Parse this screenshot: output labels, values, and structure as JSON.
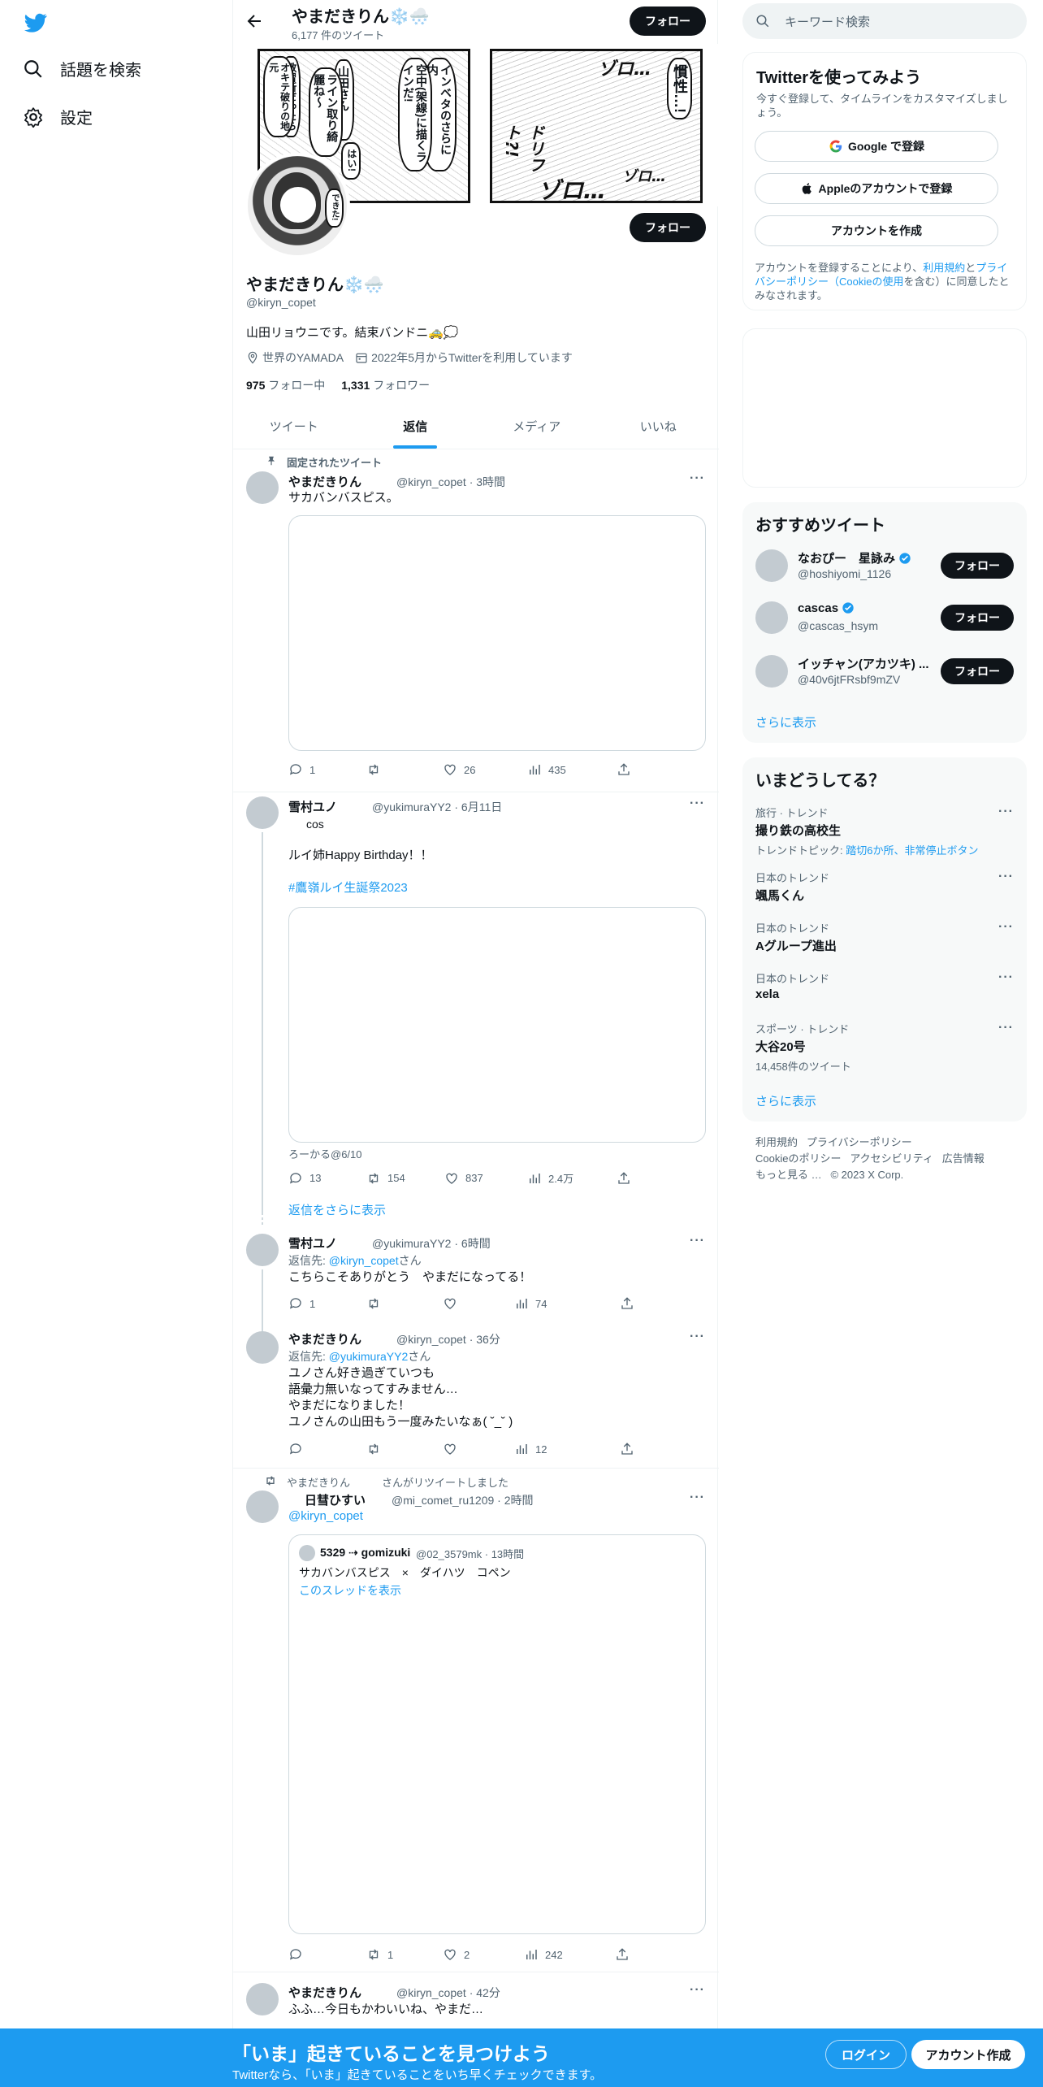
{
  "nav": {
    "explore_label": "話題を検索",
    "settings_label": "設定"
  },
  "header": {
    "name": "やまだきりん❄️🌨️",
    "tweet_count": "6,177 件のツイート",
    "follow_label": "フォロー"
  },
  "banner": {
    "manga_left_bubbles": [
      "インベタのさらに内",
      "空中(架線)に描くラインだ!",
      "山田さん…",
      "ライン取り綺麗ね〜",
      "はい!",
      "教習所だったら",
      "オキテ破りの地元",
      "できた!"
    ],
    "manga_right_text": [
      "慣性…!",
      "ドリフト?!",
      "ゾロ…",
      "ゾロ…",
      "ゾロ…"
    ]
  },
  "profile": {
    "follow_label": "フォロー",
    "name": "やまだきりん❄️🌨️",
    "handle": "@kiryn_copet",
    "bio": "山田リョウニです。結束バンドニ🚕💭",
    "location": "世界のYAMADA",
    "joined": "2022年5月からTwitterを利用しています",
    "following_count": "975",
    "following_label": "フォロー中",
    "followers_count": "1,331",
    "followers_label": "フォロワー"
  },
  "tabs": [
    {
      "label": "ツイート"
    },
    {
      "label": "返信"
    },
    {
      "label": "メディア"
    },
    {
      "label": "いいね"
    }
  ],
  "tweets": [
    {
      "pinned_label": "固定されたツイート",
      "name": "やまだきりん",
      "handle_time": "@kiryn_copet · 3時間",
      "text": "サカバンバスピス。",
      "replies": "1",
      "retweets": "",
      "likes": "26",
      "views": "435"
    },
    {
      "name": "雪村ユノ",
      "handle_time": "@yukimuraYY2 · 6月11日",
      "name_sub": "cos",
      "text": "ルイ姉Happy Birthday！！",
      "hashtag": "#鷹嶺ルイ生誕祭2023",
      "media_caption": "ろーかる@6/10",
      "replies": "13",
      "retweets": "154",
      "likes": "837",
      "views": "2.4万",
      "show_more": "返信をさらに表示"
    },
    {
      "name": "雪村ユノ",
      "handle_time": "@yukimuraYY2 · 6時間",
      "reply_to_prefix": "返信先: ",
      "reply_to": "@kiryn_copet",
      "reply_to_suffix": "さん",
      "text": "こちらこそありがとう　やまだになってる！",
      "replies": "1",
      "retweets": "",
      "likes": "",
      "views": "74"
    },
    {
      "name": "やまだきりん",
      "handle_time": "@kiryn_copet · 36分",
      "reply_to_prefix": "返信先: ",
      "reply_to": "@yukimuraYY2",
      "reply_to_suffix": "さん",
      "text_lines": [
        "ユノさん好き過ぎていつも",
        "語彙力無いなってすみません…",
        "やまだになりました！",
        "ユノさんの山田もう一度みたいなぁ( ˘_˘ )"
      ],
      "replies": "",
      "retweets": "",
      "likes": "",
      "views": "12"
    },
    {
      "retweeted_by": "やまだきりん　　　さんがリツイートしました",
      "name": "日彗ひすい",
      "handle_time": "@mi_comet_ru1209 · 2時間",
      "mention": "@kiryn_copet",
      "quote_name": "5329 ⇢ gomizuki",
      "quote_handle_time": "@02_3579mk · 13時間",
      "quote_text": "サカバンバスピス　×　ダイハツ　コペン",
      "quote_thread": "このスレッドを表示",
      "replies": "",
      "retweets": "1",
      "likes": "2",
      "views": "242"
    },
    {
      "name": "やまだきりん",
      "handle_time": "@kiryn_copet · 42分",
      "text": "ふふ…今日もかわいいね、やまだ…"
    }
  ],
  "right": {
    "search_placeholder": "キーワード検索",
    "signup_card": {
      "title": "Twitterを使ってみよう",
      "subtitle": "今すぐ登録して、タイムラインをカスタマイズしましょう。",
      "google": "Google で登録",
      "apple": "Appleのアカウントで登録",
      "create": "アカウントを作成",
      "legal_1": "アカウントを登録することにより、",
      "legal_terms": "利用規約",
      "legal_2": "と",
      "legal_privacy": "プライバシーポリシー（Cookieの使用",
      "legal_3": "を含む）に同意したとみなされます。"
    },
    "recommend": {
      "title": "おすすめツイート",
      "users": [
        {
          "name": "なおぴー　星詠み",
          "handle": "@hoshiyomi_1126",
          "verified": true
        },
        {
          "name": "cascas",
          "handle": "@cascas_hsym",
          "verified": true
        },
        {
          "name": "イッチャン(アカツキ) ...",
          "handle": "@40v6jtFRsbf9mZV",
          "verified": false
        }
      ],
      "follow_label": "フォロー",
      "more": "さらに表示"
    },
    "trends": {
      "title": "いまどうしてる？",
      "items": [
        {
          "category": "旅行 · トレンド",
          "title": "撮り鉄の高校生",
          "sub_prefix": "トレンドトピック: ",
          "sub_links": "踏切6か所、非常停止ボタン"
        },
        {
          "category": "日本のトレンド",
          "title": "颯馬くん"
        },
        {
          "category": "日本のトレンド",
          "title": "Aグループ進出"
        },
        {
          "category": "日本のトレンド",
          "title": "xela"
        },
        {
          "category": "スポーツ · トレンド",
          "title": "大谷20号",
          "sub": "14,458件のツイート"
        }
      ],
      "more": "さらに表示"
    },
    "footer": {
      "line1": [
        "利用規約",
        "プライバシーポリシー"
      ],
      "line2": [
        "Cookieのポリシー",
        "アクセシビリティ",
        "広告情報"
      ],
      "line3": [
        "もっと見る …",
        "© 2023 X Corp."
      ]
    }
  },
  "bottom": {
    "title": "「いま」起きていることを見つけよう",
    "subtitle": "Twitterなら、「いま」起きていることをいち早くチェックできます。",
    "login": "ログイン",
    "signup": "アカウント作成"
  }
}
